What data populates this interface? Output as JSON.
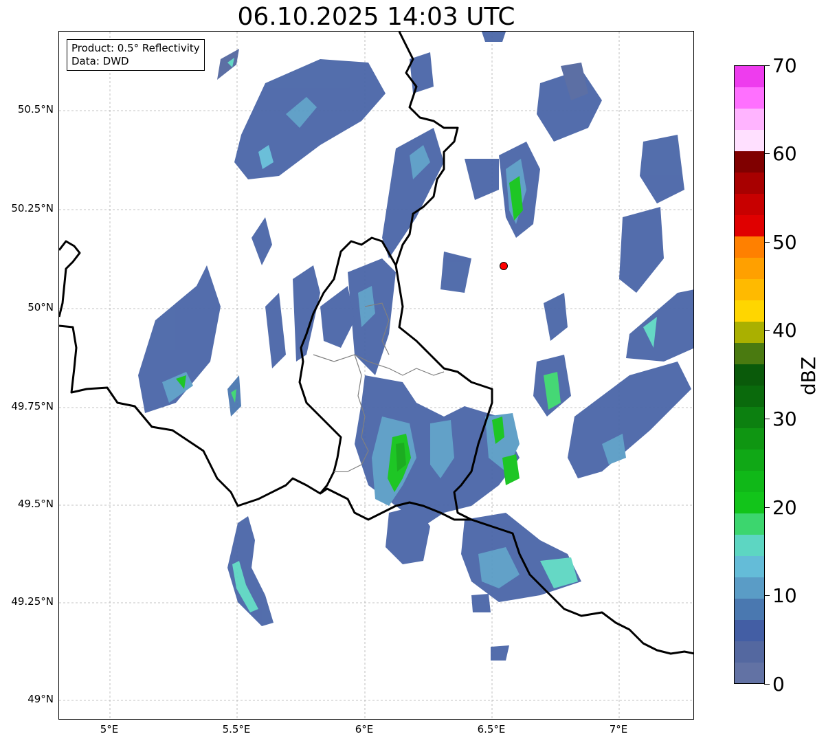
{
  "title": "06.10.2025 14:03 UTC",
  "info": {
    "product": "Product: 0.5° Reflectivity",
    "data": "Data: DWD"
  },
  "map": {
    "lat_ticks": [
      "50.5°N",
      "50.25°N",
      "50°N",
      "49.75°N",
      "49.5°N",
      "49.25°N",
      "49°N"
    ],
    "lon_ticks": [
      "5°E",
      "5.5°E",
      "6°E",
      "6.5°E",
      "7°E"
    ],
    "radar_site_color": "#ff0000",
    "border_color": "#000000",
    "subborder_color": "#808080",
    "gridline_style": "dashed-light-gray"
  },
  "colorbar": {
    "label": "dBZ",
    "min": 0,
    "max": 70,
    "tick_labels": [
      "0",
      "10",
      "20",
      "30",
      "40",
      "50",
      "60",
      "70"
    ],
    "colors": [
      "#6272a4",
      "#5468a0",
      "#435ea4",
      "#4a78b0",
      "#5a9cc6",
      "#64bcd8",
      "#5dd6c2",
      "#3cd66e",
      "#12c41a",
      "#10b818",
      "#10a816",
      "#0f9612",
      "#0c8010",
      "#0a6a0c",
      "#0a5a0a",
      "#4a7a10",
      "#aab000",
      "#ffd600",
      "#ffba00",
      "#ffa000",
      "#ff8000",
      "#e00000",
      "#c80000",
      "#a80000",
      "#800000",
      "#ffe0ff",
      "#ffb4ff",
      "#ff70ff",
      "#ee3cee"
    ]
  }
}
